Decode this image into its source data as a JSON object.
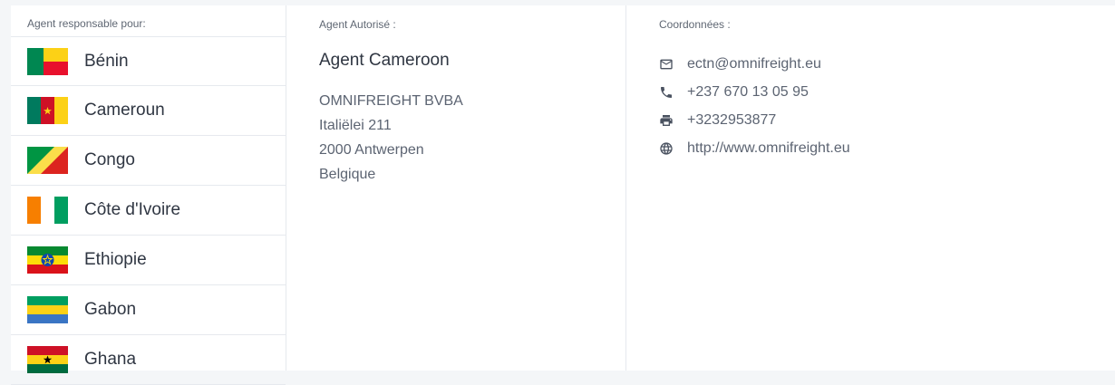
{
  "left": {
    "title": "Agent responsable pour:",
    "countries": [
      {
        "name": "Bénin",
        "flag": "benin-flag-icon"
      },
      {
        "name": "Cameroun",
        "flag": "cameroon-flag-icon"
      },
      {
        "name": "Congo",
        "flag": "congo-flag-icon"
      },
      {
        "name": "Côte d'Ivoire",
        "flag": "ivory-coast-flag-icon"
      },
      {
        "name": "Ethiopie",
        "flag": "ethiopia-flag-icon"
      },
      {
        "name": "Gabon",
        "flag": "gabon-flag-icon"
      },
      {
        "name": "Ghana",
        "flag": "ghana-flag-icon"
      }
    ]
  },
  "middle": {
    "title": "Agent Autorisé :",
    "agent_name": "Agent Cameroon",
    "address": [
      "OMNIFREIGHT BVBA",
      "Italiëlei 211",
      "2000 Antwerpen",
      "Belgique"
    ]
  },
  "right": {
    "title": "Coordonnées :",
    "contacts": [
      {
        "icon": "email-icon",
        "value": "ectn@omnifreight.eu"
      },
      {
        "icon": "phone-icon",
        "value": "+237 670 13 05 95"
      },
      {
        "icon": "fax-icon",
        "value": "+3232953877"
      },
      {
        "icon": "globe-icon",
        "value": "http://www.omnifreight.eu"
      }
    ]
  }
}
